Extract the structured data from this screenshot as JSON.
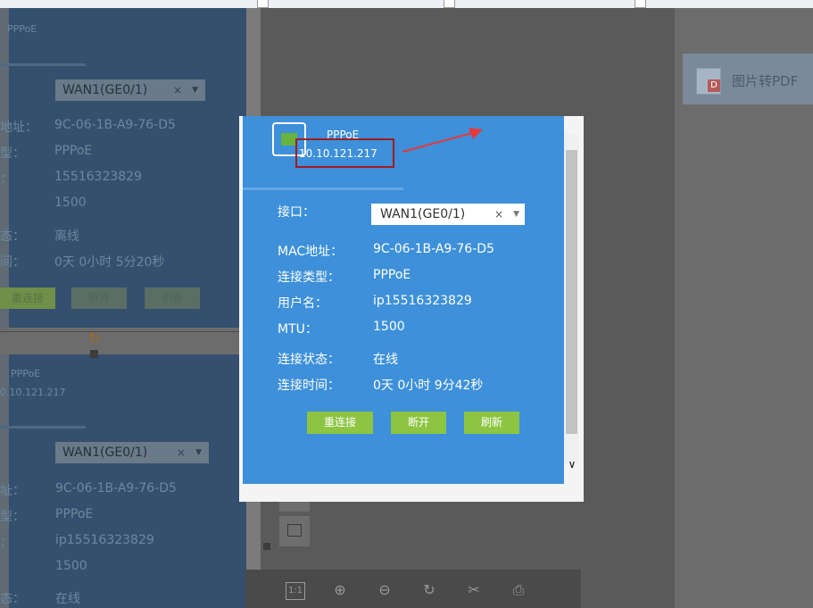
{
  "left_panel": {
    "top_label": "PPPoE",
    "section1": {
      "interface_value": "WAN1(GE0/1)",
      "mac_label": "地址：",
      "mac_value": "9C-06-1B-A9-76-D5",
      "type_label": "型：",
      "type_value": "PPPoE",
      "user_label": "：",
      "user_value": "15516323829",
      "mtu_value": "1500",
      "status_label": "态：",
      "status_value": "离线",
      "time_label": "间：",
      "time_value": "0天 0小时 5分20秒",
      "buttons": [
        "重连接",
        "断开",
        "刷新"
      ]
    },
    "section2": {
      "pppoe": "PPPoE",
      "ip": "0.10.121.217",
      "interface_value": "WAN1(GE0/1)",
      "mac_label": "址：",
      "mac_value": "9C-06-1B-A9-76-D5",
      "type_label": "型：",
      "type_value": "PPPoE",
      "user_label": "：",
      "user_value": "ip15516323829",
      "mtu_value": "1500",
      "status_label": "态：",
      "status_value": "在线"
    }
  },
  "popup": {
    "pppoe_label": "PPPoE",
    "ip": "10.10.121.217",
    "interface_label": "接口：",
    "interface_value": "WAN1(GE0/1)",
    "fields": [
      {
        "label": "MAC地址：",
        "value": "9C-06-1B-A9-76-D5"
      },
      {
        "label": "连接类型：",
        "value": "PPPoE"
      },
      {
        "label": "用户名：",
        "value": "ip15516323829"
      },
      {
        "label": "MTU：",
        "value": "1500"
      },
      {
        "label": "连接状态：",
        "value": "在线"
      },
      {
        "label": "连接时间：",
        "value": "0天 0小时 9分42秒"
      }
    ],
    "buttons": {
      "reconnect": "重连接",
      "disconnect": "断开",
      "refresh": "刷新"
    },
    "clear_symbol": "×",
    "dropdown_symbol": "▼"
  },
  "right_panel": {
    "pdf_button": "图片转PDF"
  },
  "toolbar": {
    "icons": [
      "actual-size-icon",
      "zoom-in-icon",
      "zoom-out-icon",
      "rotate-icon",
      "crop-icon",
      "save-icon"
    ],
    "actual_size_label": "1:1"
  },
  "colors": {
    "panel_blue": "#3d90d9",
    "button_green": "#8dc542",
    "highlight_red": "#a01c1c",
    "arrow_red": "#e8393a"
  }
}
